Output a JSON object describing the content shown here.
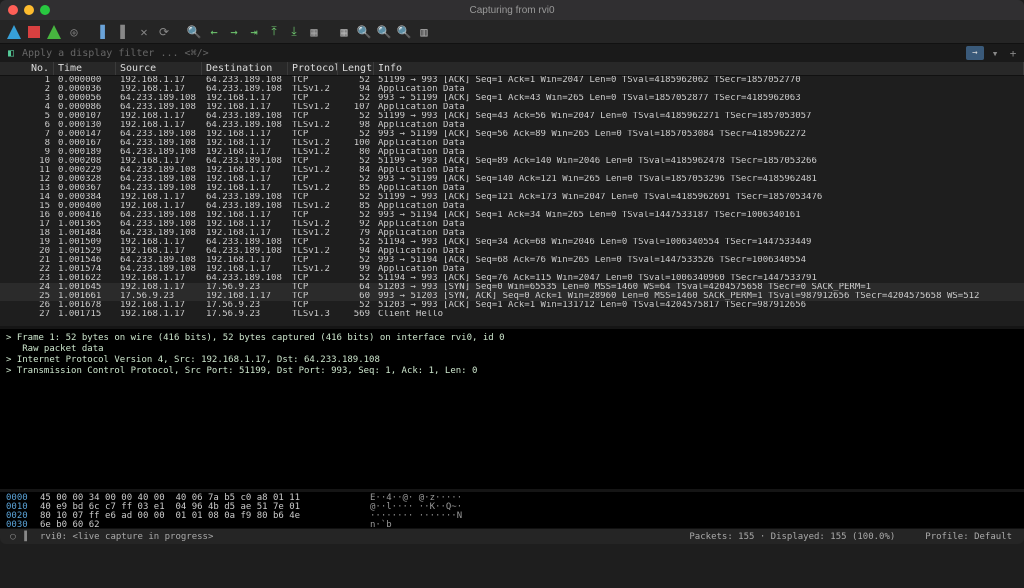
{
  "window": {
    "title": "Capturing from rvi0"
  },
  "filter": {
    "placeholder": "Apply a display filter ... <⌘/>"
  },
  "columns": [
    "No.",
    "Time",
    "Source",
    "Destination",
    "Protocol",
    "Length",
    "Info"
  ],
  "packets": [
    {
      "no": 1,
      "time": "0.000000",
      "src": "192.168.1.17",
      "dst": "64.233.189.108",
      "proto": "TCP",
      "len": 52,
      "info": "51199 → 993 [ACK] Seq=1 Ack=1 Win=2047 Len=0 TSval=4185962062 TSecr=1857052770"
    },
    {
      "no": 2,
      "time": "0.000036",
      "src": "192.168.1.17",
      "dst": "64.233.189.108",
      "proto": "TLSv1.2",
      "len": 94,
      "info": "Application Data"
    },
    {
      "no": 3,
      "time": "0.000056",
      "src": "64.233.189.108",
      "dst": "192.168.1.17",
      "proto": "TCP",
      "len": 52,
      "info": "993 → 51199 [ACK] Seq=1 Ack=43 Win=265 Len=0 TSval=1857052877 TSecr=4185962063"
    },
    {
      "no": 4,
      "time": "0.000086",
      "src": "64.233.189.108",
      "dst": "192.168.1.17",
      "proto": "TLSv1.2",
      "len": 107,
      "info": "Application Data"
    },
    {
      "no": 5,
      "time": "0.000107",
      "src": "192.168.1.17",
      "dst": "64.233.189.108",
      "proto": "TCP",
      "len": 52,
      "info": "51199 → 993 [ACK] Seq=43 Ack=56 Win=2047 Len=0 TSval=4185962271 TSecr=1857053057"
    },
    {
      "no": 6,
      "time": "0.000130",
      "src": "192.168.1.17",
      "dst": "64.233.189.108",
      "proto": "TLSv1.2",
      "len": 98,
      "info": "Application Data"
    },
    {
      "no": 7,
      "time": "0.000147",
      "src": "64.233.189.108",
      "dst": "192.168.1.17",
      "proto": "TCP",
      "len": 52,
      "info": "993 → 51199 [ACK] Seq=56 Ack=89 Win=265 Len=0 TSval=1857053084 TSecr=4185962272"
    },
    {
      "no": 8,
      "time": "0.000167",
      "src": "64.233.189.108",
      "dst": "192.168.1.17",
      "proto": "TLSv1.2",
      "len": 100,
      "info": "Application Data"
    },
    {
      "no": 9,
      "time": "0.000189",
      "src": "64.233.189.108",
      "dst": "192.168.1.17",
      "proto": "TLSv1.2",
      "len": 80,
      "info": "Application Data"
    },
    {
      "no": 10,
      "time": "0.000208",
      "src": "192.168.1.17",
      "dst": "64.233.189.108",
      "proto": "TCP",
      "len": 52,
      "info": "51199 → 993 [ACK] Seq=89 Ack=140 Win=2046 Len=0 TSval=4185962478 TSecr=1857053266"
    },
    {
      "no": 11,
      "time": "0.000229",
      "src": "64.233.189.108",
      "dst": "192.168.1.17",
      "proto": "TLSv1.2",
      "len": 84,
      "info": "Application Data"
    },
    {
      "no": 12,
      "time": "0.000328",
      "src": "64.233.189.108",
      "dst": "192.168.1.17",
      "proto": "TCP",
      "len": 52,
      "info": "993 → 51199 [ACK] Seq=140 Ack=121 Win=265 Len=0 TSval=1857053296 TSecr=4185962481"
    },
    {
      "no": 13,
      "time": "0.000367",
      "src": "64.233.189.108",
      "dst": "192.168.1.17",
      "proto": "TLSv1.2",
      "len": 85,
      "info": "Application Data"
    },
    {
      "no": 14,
      "time": "0.000384",
      "src": "192.168.1.17",
      "dst": "64.233.189.108",
      "proto": "TCP",
      "len": 52,
      "info": "51199 → 993 [ACK] Seq=121 Ack=173 Win=2047 Len=0 TSval=4185962691 TSecr=1857053476"
    },
    {
      "no": 15,
      "time": "0.000400",
      "src": "192.168.1.17",
      "dst": "64.233.189.108",
      "proto": "TLSv1.2",
      "len": 85,
      "info": "Application Data"
    },
    {
      "no": 16,
      "time": "0.000416",
      "src": "64.233.189.108",
      "dst": "192.168.1.17",
      "proto": "TCP",
      "len": 52,
      "info": "993 → 51194 [ACK] Seq=1 Ack=34 Win=265 Len=0 TSval=1447533187 TSecr=1006340161"
    },
    {
      "no": 17,
      "time": "1.001365",
      "src": "64.233.189.108",
      "dst": "192.168.1.17",
      "proto": "TLSv1.2",
      "len": 92,
      "info": "Application Data"
    },
    {
      "no": 18,
      "time": "1.001484",
      "src": "64.233.189.108",
      "dst": "192.168.1.17",
      "proto": "TLSv1.2",
      "len": 79,
      "info": "Application Data"
    },
    {
      "no": 19,
      "time": "1.001509",
      "src": "192.168.1.17",
      "dst": "64.233.189.108",
      "proto": "TCP",
      "len": 52,
      "info": "51194 → 993 [ACK] Seq=34 Ack=68 Win=2046 Len=0 TSval=1006340554 TSecr=1447533449"
    },
    {
      "no": 20,
      "time": "1.001529",
      "src": "192.168.1.17",
      "dst": "64.233.189.108",
      "proto": "TLSv1.2",
      "len": 94,
      "info": "Application Data"
    },
    {
      "no": 21,
      "time": "1.001546",
      "src": "64.233.189.108",
      "dst": "192.168.1.17",
      "proto": "TCP",
      "len": 52,
      "info": "993 → 51194 [ACK] Seq=68 Ack=76 Win=265 Len=0 TSval=1447533526 TSecr=1006340554"
    },
    {
      "no": 22,
      "time": "1.001574",
      "src": "64.233.189.108",
      "dst": "192.168.1.17",
      "proto": "TLSv1.2",
      "len": 99,
      "info": "Application Data"
    },
    {
      "no": 23,
      "time": "1.001622",
      "src": "192.168.1.17",
      "dst": "64.233.189.108",
      "proto": "TCP",
      "len": 52,
      "info": "51194 → 993 [ACK] Seq=76 Ack=115 Win=2047 Len=0 TSval=1006340960 TSecr=1447533791"
    },
    {
      "no": 24,
      "time": "1.001645",
      "src": "192.168.1.17",
      "dst": "17.56.9.23",
      "proto": "TCP",
      "len": 64,
      "info": "51203 → 993 [SYN] Seq=0 Win=65535 Len=0 MSS=1460 WS=64 TSval=4204575658 TSecr=0 SACK_PERM=1"
    },
    {
      "no": 25,
      "time": "1.001661",
      "src": "17.56.9.23",
      "dst": "192.168.1.17",
      "proto": "TCP",
      "len": 60,
      "info": "993 → 51203 [SYN, ACK] Seq=0 Ack=1 Win=28960 Len=0 MSS=1460 SACK_PERM=1 TSval=987912656 TSecr=4204575658 WS=512"
    },
    {
      "no": 26,
      "time": "1.001678",
      "src": "192.168.1.17",
      "dst": "17.56.9.23",
      "proto": "TCP",
      "len": 52,
      "info": "51203 → 993 [ACK] Seq=1 Ack=1 Win=131712 Len=0 TSval=4204575817 TSecr=987912656"
    },
    {
      "no": 27,
      "time": "1.001715",
      "src": "192.168.1.17",
      "dst": "17.56.9.23",
      "proto": "TLSv1.3",
      "len": 569,
      "info": "Client Hello"
    }
  ],
  "selected": [
    24,
    25
  ],
  "details": [
    "> Frame 1: 52 bytes on wire (416 bits), 52 bytes captured (416 bits) on interface rvi0, id 0",
    "   Raw packet data",
    "> Internet Protocol Version 4, Src: 192.168.1.17, Dst: 64.233.189.108",
    "> Transmission Control Protocol, Src Port: 51199, Dst Port: 993, Seq: 1, Ack: 1, Len: 0"
  ],
  "hex": [
    {
      "off": "0000",
      "hex": "45 00 00 34 00 00 40 00  40 06 7a b5 c0 a8 01 11",
      "asc": "E··4··@· @·z·····"
    },
    {
      "off": "0010",
      "hex": "40 e9 bd 6c c7 ff 03 e1  04 96 4b d5 ae 51 7e 01",
      "asc": "@··l···· ··K··Q~·"
    },
    {
      "off": "0020",
      "hex": "80 10 07 ff e6 ad 00 00  01 01 08 0a f9 80 b6 4e",
      "asc": "········ ·······N"
    },
    {
      "off": "0030",
      "hex": "6e b0 60 62",
      "asc": "n·`b"
    }
  ],
  "status": {
    "file": "rvi0: <live capture in progress>",
    "packets": "Packets: 155 · Displayed: 155 (100.0%)",
    "profile": "Profile: Default"
  }
}
